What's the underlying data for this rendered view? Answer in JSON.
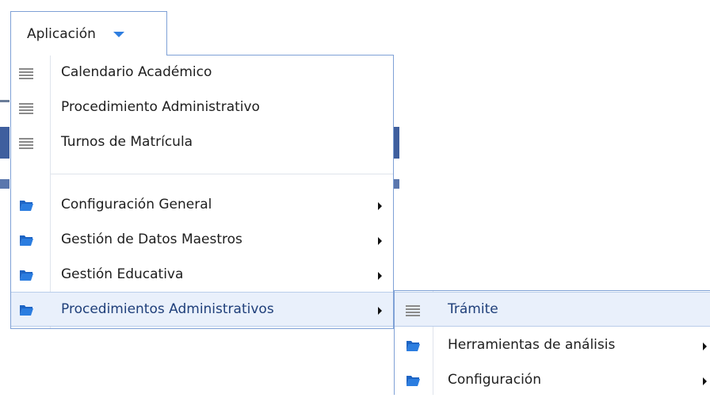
{
  "menu_button": {
    "label": "Aplicación",
    "icon": "chevron-down-icon",
    "accent": "#2f7ee0"
  },
  "main_menu": {
    "items": [
      {
        "label": "Calendario Académico",
        "icon": "list-icon"
      },
      {
        "label": "Procedimiento Administrativo",
        "icon": "list-icon"
      },
      {
        "label": "Turnos de Matrícula",
        "icon": "list-icon"
      },
      {
        "label": "Configuración General",
        "icon": "folder-icon",
        "submenu": true
      },
      {
        "label": "Gestión de Datos Maestros",
        "icon": "folder-icon",
        "submenu": true
      },
      {
        "label": "Gestión Educativa",
        "icon": "folder-icon",
        "submenu": true
      },
      {
        "label": "Procedimientos Administrativos",
        "icon": "folder-icon",
        "submenu": true,
        "highlighted": true
      }
    ]
  },
  "sub_menu": {
    "items": [
      {
        "label": "Trámite",
        "icon": "list-icon",
        "highlighted": true
      },
      {
        "label": "Herramientas de análisis",
        "icon": "folder-icon",
        "submenu": true
      },
      {
        "label": "Configuración",
        "icon": "folder-icon",
        "submenu": true
      }
    ]
  },
  "colors": {
    "border": "#7fa1d6",
    "highlight": "#e9f0fb",
    "folder": "#2b7de0"
  }
}
